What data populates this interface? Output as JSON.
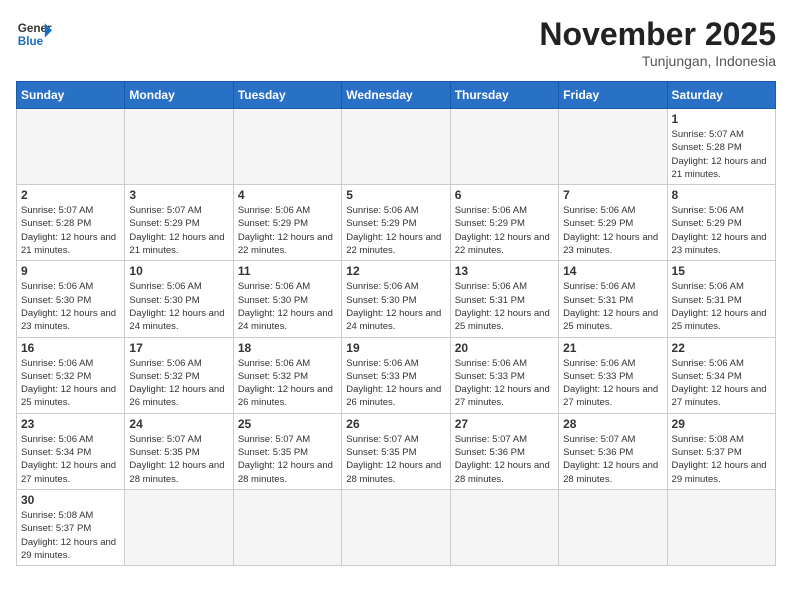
{
  "header": {
    "logo_general": "General",
    "logo_blue": "Blue",
    "month_title": "November 2025",
    "location": "Tunjungan, Indonesia"
  },
  "days_of_week": [
    "Sunday",
    "Monday",
    "Tuesday",
    "Wednesday",
    "Thursday",
    "Friday",
    "Saturday"
  ],
  "weeks": [
    [
      {
        "day": "",
        "info": ""
      },
      {
        "day": "",
        "info": ""
      },
      {
        "day": "",
        "info": ""
      },
      {
        "day": "",
        "info": ""
      },
      {
        "day": "",
        "info": ""
      },
      {
        "day": "",
        "info": ""
      },
      {
        "day": "1",
        "info": "Sunrise: 5:07 AM\nSunset: 5:28 PM\nDaylight: 12 hours\nand 21 minutes."
      }
    ],
    [
      {
        "day": "2",
        "info": "Sunrise: 5:07 AM\nSunset: 5:28 PM\nDaylight: 12 hours\nand 21 minutes."
      },
      {
        "day": "3",
        "info": "Sunrise: 5:07 AM\nSunset: 5:29 PM\nDaylight: 12 hours\nand 21 minutes."
      },
      {
        "day": "4",
        "info": "Sunrise: 5:06 AM\nSunset: 5:29 PM\nDaylight: 12 hours\nand 22 minutes."
      },
      {
        "day": "5",
        "info": "Sunrise: 5:06 AM\nSunset: 5:29 PM\nDaylight: 12 hours\nand 22 minutes."
      },
      {
        "day": "6",
        "info": "Sunrise: 5:06 AM\nSunset: 5:29 PM\nDaylight: 12 hours\nand 22 minutes."
      },
      {
        "day": "7",
        "info": "Sunrise: 5:06 AM\nSunset: 5:29 PM\nDaylight: 12 hours\nand 23 minutes."
      },
      {
        "day": "8",
        "info": "Sunrise: 5:06 AM\nSunset: 5:29 PM\nDaylight: 12 hours\nand 23 minutes."
      }
    ],
    [
      {
        "day": "9",
        "info": "Sunrise: 5:06 AM\nSunset: 5:30 PM\nDaylight: 12 hours\nand 23 minutes."
      },
      {
        "day": "10",
        "info": "Sunrise: 5:06 AM\nSunset: 5:30 PM\nDaylight: 12 hours\nand 24 minutes."
      },
      {
        "day": "11",
        "info": "Sunrise: 5:06 AM\nSunset: 5:30 PM\nDaylight: 12 hours\nand 24 minutes."
      },
      {
        "day": "12",
        "info": "Sunrise: 5:06 AM\nSunset: 5:30 PM\nDaylight: 12 hours\nand 24 minutes."
      },
      {
        "day": "13",
        "info": "Sunrise: 5:06 AM\nSunset: 5:31 PM\nDaylight: 12 hours\nand 25 minutes."
      },
      {
        "day": "14",
        "info": "Sunrise: 5:06 AM\nSunset: 5:31 PM\nDaylight: 12 hours\nand 25 minutes."
      },
      {
        "day": "15",
        "info": "Sunrise: 5:06 AM\nSunset: 5:31 PM\nDaylight: 12 hours\nand 25 minutes."
      }
    ],
    [
      {
        "day": "16",
        "info": "Sunrise: 5:06 AM\nSunset: 5:32 PM\nDaylight: 12 hours\nand 25 minutes."
      },
      {
        "day": "17",
        "info": "Sunrise: 5:06 AM\nSunset: 5:32 PM\nDaylight: 12 hours\nand 26 minutes."
      },
      {
        "day": "18",
        "info": "Sunrise: 5:06 AM\nSunset: 5:32 PM\nDaylight: 12 hours\nand 26 minutes."
      },
      {
        "day": "19",
        "info": "Sunrise: 5:06 AM\nSunset: 5:33 PM\nDaylight: 12 hours\nand 26 minutes."
      },
      {
        "day": "20",
        "info": "Sunrise: 5:06 AM\nSunset: 5:33 PM\nDaylight: 12 hours\nand 27 minutes."
      },
      {
        "day": "21",
        "info": "Sunrise: 5:06 AM\nSunset: 5:33 PM\nDaylight: 12 hours\nand 27 minutes."
      },
      {
        "day": "22",
        "info": "Sunrise: 5:06 AM\nSunset: 5:34 PM\nDaylight: 12 hours\nand 27 minutes."
      }
    ],
    [
      {
        "day": "23",
        "info": "Sunrise: 5:06 AM\nSunset: 5:34 PM\nDaylight: 12 hours\nand 27 minutes."
      },
      {
        "day": "24",
        "info": "Sunrise: 5:07 AM\nSunset: 5:35 PM\nDaylight: 12 hours\nand 28 minutes."
      },
      {
        "day": "25",
        "info": "Sunrise: 5:07 AM\nSunset: 5:35 PM\nDaylight: 12 hours\nand 28 minutes."
      },
      {
        "day": "26",
        "info": "Sunrise: 5:07 AM\nSunset: 5:35 PM\nDaylight: 12 hours\nand 28 minutes."
      },
      {
        "day": "27",
        "info": "Sunrise: 5:07 AM\nSunset: 5:36 PM\nDaylight: 12 hours\nand 28 minutes."
      },
      {
        "day": "28",
        "info": "Sunrise: 5:07 AM\nSunset: 5:36 PM\nDaylight: 12 hours\nand 28 minutes."
      },
      {
        "day": "29",
        "info": "Sunrise: 5:08 AM\nSunset: 5:37 PM\nDaylight: 12 hours\nand 29 minutes."
      }
    ],
    [
      {
        "day": "30",
        "info": "Sunrise: 5:08 AM\nSunset: 5:37 PM\nDaylight: 12 hours\nand 29 minutes."
      },
      {
        "day": "",
        "info": ""
      },
      {
        "day": "",
        "info": ""
      },
      {
        "day": "",
        "info": ""
      },
      {
        "day": "",
        "info": ""
      },
      {
        "day": "",
        "info": ""
      },
      {
        "day": "",
        "info": ""
      }
    ]
  ]
}
